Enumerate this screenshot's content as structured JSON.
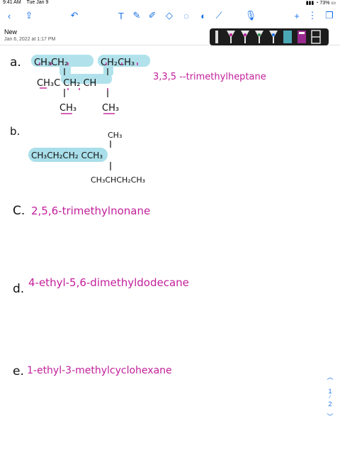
{
  "status": {
    "time": "9:41 AM",
    "date": "Tue Jan 9",
    "battery": "73%"
  },
  "toolbar": {
    "icons": [
      "chevron-left-icon",
      "share-icon",
      "undo-icon",
      "text-tool-icon",
      "pen-tool-icon",
      "highlighter-icon",
      "eraser-icon",
      "lasso-icon",
      "shapes-icon",
      "ruler-icon",
      "microphone-icon",
      "add-icon",
      "more-icon",
      "pages-icon"
    ]
  },
  "note": {
    "title": "New",
    "date": "Jan 6, 2022 at 1:17 PM"
  },
  "colors": {
    "ink": "#111111",
    "magenta": "#c21f9a",
    "highlight": "#a9dfea",
    "accent": "#1a73e8"
  },
  "problems": {
    "a_label": "a.",
    "a_answer": "3,3,5 --trimethylheptane",
    "b_label": "b.",
    "c_label": "C.",
    "c_text": "2,5,6-trimethylnonane",
    "d_label": "d.",
    "d_text": "4-ethyl-5,6-dimethyldodecane",
    "e_label": "e.",
    "e_text": "1-ethyl-3-methylcyclohexane"
  },
  "structures": {
    "a_top_left": "CH₃CH₂",
    "a_top_right": "CH₂CH₃",
    "a_main": "CH₃C CH₂ CH",
    "a_bottom_left": "CH₃",
    "a_bottom_right": "CH₃",
    "b_top": "CH₃",
    "b_main": "CH₃CH₂CH₂ CCH₃",
    "b_bottom": "CH₃CHCH₂CH₃"
  },
  "pager": {
    "page": "1",
    "total": "2"
  }
}
